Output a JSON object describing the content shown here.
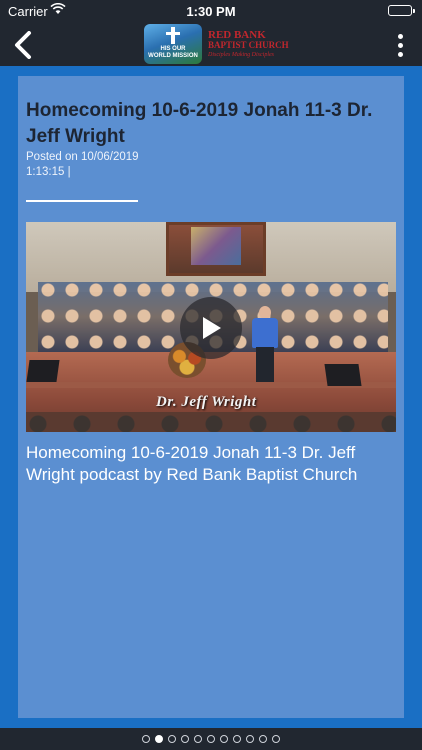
{
  "status_bar": {
    "carrier": "Carrier",
    "time": "1:30 PM"
  },
  "nav": {
    "back_icon": "chevron-left-icon",
    "menu_icon": "vertical-dots-icon",
    "logo": {
      "globe_text_1": "HIS  OUR",
      "globe_text_2": "WORLD  MISSION",
      "name_line1": "RED BANK",
      "name_line2": "BAPTIST CHURCH",
      "tagline": "Disciples Making Disciples"
    }
  },
  "post": {
    "title": "Homecoming 10-6-2019 Jonah 11-3 Dr. Jeff Wright",
    "posted_on": "Posted on 10/06/2019",
    "duration": "1:13:15 |",
    "video_caption": "Dr. Jeff Wright",
    "description": "Homecoming 10-6-2019 Jonah 11-3 Dr. Jeff Wright podcast by Red Bank Baptist Church"
  },
  "pager": {
    "count": 11,
    "active_index": 1
  },
  "colors": {
    "background": "#1a6fc4",
    "card": "#5b8fd1",
    "bar": "#212730",
    "brand_red": "#c1272d"
  }
}
